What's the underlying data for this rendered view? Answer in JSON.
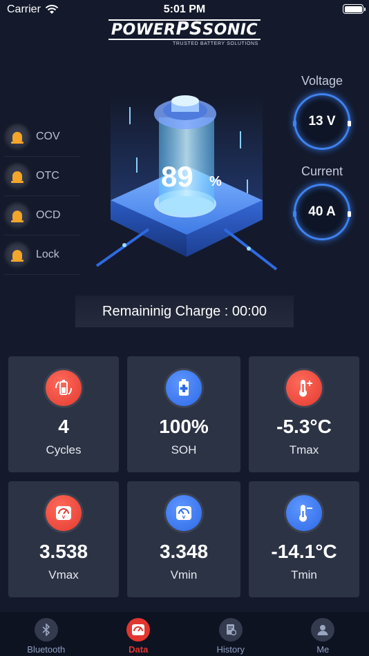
{
  "status_bar": {
    "carrier": "Carrier",
    "time": "5:01 PM"
  },
  "logo": {
    "name": "POWERPSSONIC",
    "tagline": "TRUSTED BATTERY SOLUTIONS"
  },
  "alarms": [
    {
      "label": "COV",
      "icon": "alarm-light-icon"
    },
    {
      "label": "OTC",
      "icon": "alarm-light-icon"
    },
    {
      "label": "OCD",
      "icon": "alarm-light-icon"
    },
    {
      "label": "Lock",
      "icon": "alarm-light-icon"
    }
  ],
  "state_of_charge": {
    "value": "89",
    "unit": "%",
    "fraction": 0.89
  },
  "voltage": {
    "label": "Voltage",
    "value": "13 V"
  },
  "current": {
    "label": "Current",
    "value": "40 A"
  },
  "remaining_charge": "Remaininig Charge : 00:00",
  "cards": [
    {
      "value": "4",
      "label": "Cycles",
      "icon": "battery-cycle-icon",
      "color": "#e23b30"
    },
    {
      "value": "100%",
      "label": "SOH",
      "icon": "battery-health-icon",
      "color": "#2e6ae6"
    },
    {
      "value": "-5.3°C",
      "label": "Tmax",
      "icon": "thermometer-plus-icon",
      "color": "#e23b30"
    },
    {
      "value": "3.538",
      "label": "Vmax",
      "icon": "voltmeter-icon",
      "color": "#e23b30"
    },
    {
      "value": "3.348",
      "label": "Vmin",
      "icon": "voltmeter-icon",
      "color": "#2e6ae6"
    },
    {
      "value": "-14.1°C",
      "label": "Tmin",
      "icon": "thermometer-minus-icon",
      "color": "#2e6ae6"
    }
  ],
  "tabs": [
    {
      "label": "Bluetooth",
      "icon": "bluetooth-icon",
      "active": false
    },
    {
      "label": "Data",
      "icon": "gauge-icon",
      "active": true
    },
    {
      "label": "History",
      "icon": "history-icon",
      "active": false
    },
    {
      "label": "Me",
      "icon": "person-icon",
      "active": false
    }
  ],
  "colors": {
    "accent_red": "#e2362f",
    "accent_blue": "#3f83f0",
    "background": "#141a2c",
    "card": "#2c3344"
  }
}
